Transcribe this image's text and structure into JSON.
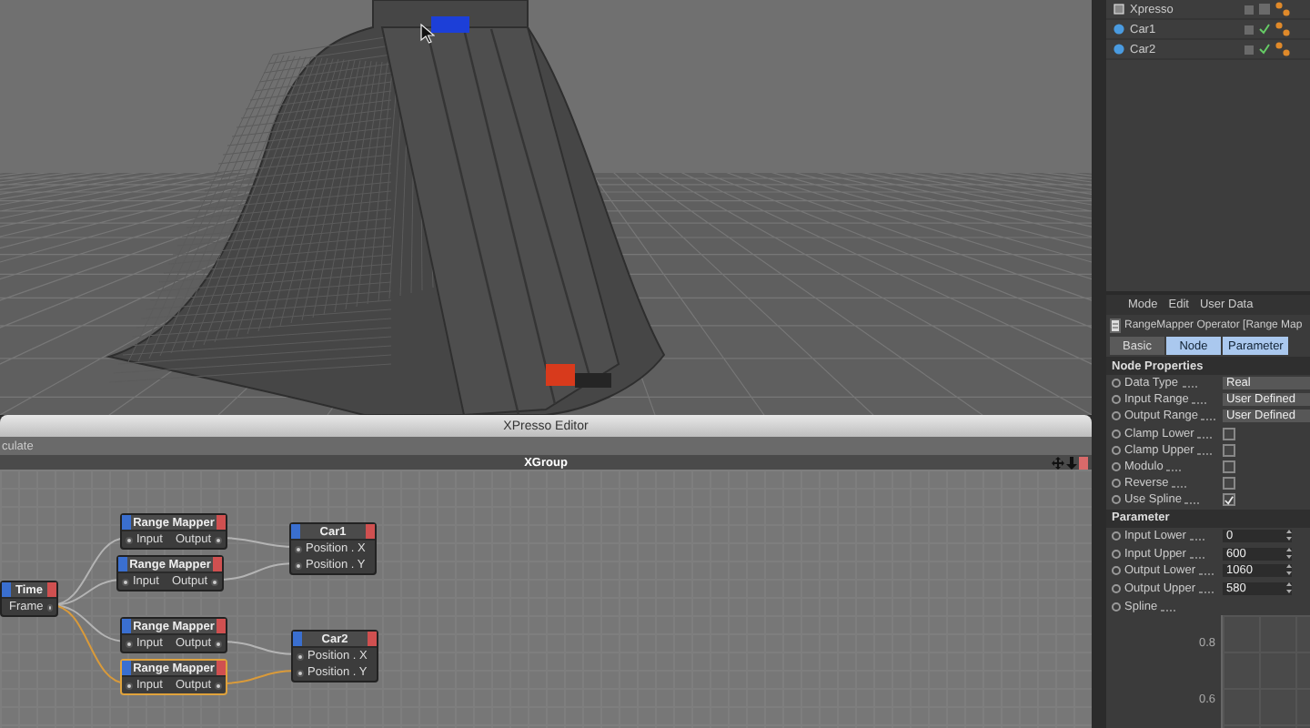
{
  "object_manager": {
    "items": [
      {
        "name": "Xpresso",
        "kind": "xpresso"
      },
      {
        "name": "Car1",
        "kind": "object"
      },
      {
        "name": "Car2",
        "kind": "object"
      }
    ]
  },
  "xpresso": {
    "title": "XPresso Editor",
    "toolbar": "culate",
    "group": "XGroup",
    "nodes": [
      {
        "title": "Time",
        "rows": [
          {
            "label": "Frame",
            "kind": "output"
          }
        ],
        "selected": false
      },
      {
        "title": "Range Mapper",
        "rows": [
          {
            "label": "Input",
            "kind": "both",
            "label_2": "Output"
          }
        ],
        "selected": false
      },
      {
        "title": "Range Mapper",
        "rows": [
          {
            "label": "Input",
            "kind": "both",
            "label_2": "Output"
          }
        ],
        "selected": false
      },
      {
        "title": "Car1",
        "rows": [
          {
            "label": "Position . X",
            "kind": "input"
          },
          {
            "label": "Position . Y",
            "kind": "input"
          }
        ],
        "selected": false
      },
      {
        "title": "Range Mapper",
        "rows": [
          {
            "label": "Input",
            "kind": "both",
            "label_2": "Output"
          }
        ],
        "selected": false
      },
      {
        "title": "Range Mapper",
        "rows": [
          {
            "label": "Input",
            "kind": "both",
            "label_2": "Output"
          }
        ],
        "selected": true
      },
      {
        "title": "Car2",
        "rows": [
          {
            "label": "Position . X",
            "kind": "input"
          },
          {
            "label": "Position . Y",
            "kind": "input"
          }
        ],
        "selected": false
      }
    ],
    "wires": [
      {
        "selected": false
      },
      {
        "selected": false
      },
      {
        "selected": false
      },
      {
        "selected": true
      },
      {
        "selected": false
      },
      {
        "selected": false
      },
      {
        "selected": false
      },
      {
        "selected": true
      }
    ]
  },
  "attributes": {
    "menu": [
      "Mode",
      "Edit",
      "User Data"
    ],
    "title": "RangeMapper Operator [Range Map",
    "tabs": [
      {
        "label": "Basic",
        "selected": false
      },
      {
        "label": "Node",
        "selected": true
      },
      {
        "label": "Parameter",
        "selected": true
      }
    ],
    "sections": [
      {
        "title": "Node Properties",
        "rows": [
          {
            "kind": "dropdown",
            "label": "Data Type",
            "value": "Real"
          },
          {
            "kind": "dropdown",
            "label": "Input Range",
            "value": "User Defined"
          },
          {
            "kind": "dropdown",
            "label": "Output Range",
            "value": "User Defined"
          },
          {
            "kind": "checkbox",
            "label": "Clamp Lower",
            "checked": false
          },
          {
            "kind": "checkbox",
            "label": "Clamp Upper",
            "checked": false
          },
          {
            "kind": "checkbox",
            "label": "Modulo",
            "checked": false
          },
          {
            "kind": "checkbox",
            "label": "Reverse",
            "checked": false
          },
          {
            "kind": "checkbox",
            "label": "Use Spline",
            "checked": true
          }
        ]
      },
      {
        "title": "Parameter",
        "rows": [
          {
            "kind": "number",
            "label": "Input Lower",
            "value": "0"
          },
          {
            "kind": "number",
            "label": "Input Upper",
            "value": "600"
          },
          {
            "kind": "number",
            "label": "Output Lower",
            "value": "1060"
          },
          {
            "kind": "number",
            "label": "Output Upper",
            "value": "580"
          },
          {
            "kind": "spline",
            "label": "Spline"
          }
        ]
      }
    ],
    "spline_labels": [
      "0.8",
      "0.6"
    ]
  }
}
